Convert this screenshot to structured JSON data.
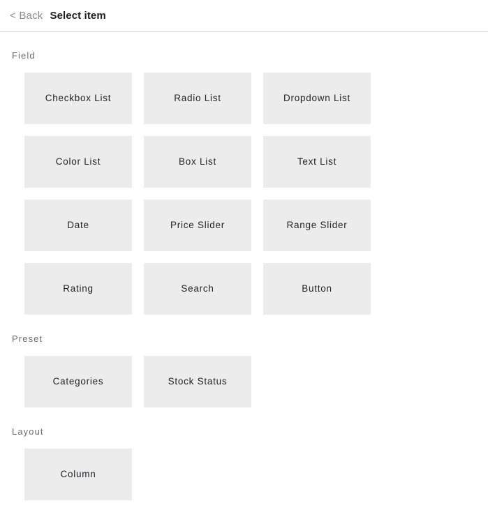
{
  "header": {
    "back_label": "< Back",
    "title": "Select item"
  },
  "sections": [
    {
      "id": "field",
      "label": "Field",
      "items": [
        {
          "label": "Checkbox List"
        },
        {
          "label": "Radio List"
        },
        {
          "label": "Dropdown List"
        },
        {
          "label": "Color List"
        },
        {
          "label": "Box List"
        },
        {
          "label": "Text List"
        },
        {
          "label": "Date"
        },
        {
          "label": "Price Slider"
        },
        {
          "label": "Range Slider"
        },
        {
          "label": "Rating"
        },
        {
          "label": "Search"
        },
        {
          "label": "Button"
        }
      ]
    },
    {
      "id": "preset",
      "label": "Preset",
      "items": [
        {
          "label": "Categories"
        },
        {
          "label": "Stock Status"
        }
      ]
    },
    {
      "id": "layout",
      "label": "Layout",
      "items": [
        {
          "label": "Column"
        }
      ]
    }
  ],
  "colors": {
    "card_background": "#ececec",
    "card_text": "#242428",
    "section_label": "#6f6f6f",
    "back_link": "#8c8c8c",
    "title": "#1f1f22",
    "divider": "#d7d7d9",
    "page_background": "#ffffff"
  }
}
